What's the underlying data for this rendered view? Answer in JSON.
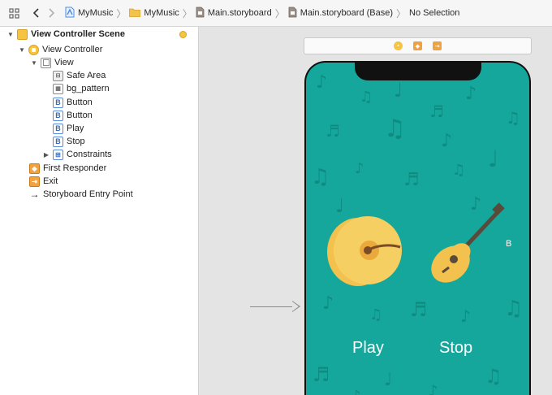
{
  "jumpbar": {
    "crumbs": [
      {
        "label": "MyMusic",
        "icon": "project-icon"
      },
      {
        "label": "MyMusic",
        "icon": "folder-icon"
      },
      {
        "label": "Main.storyboard",
        "icon": "storyboard-file-icon"
      },
      {
        "label": "Main.storyboard (Base)",
        "icon": "storyboard-file-icon"
      },
      {
        "label": "No Selection",
        "icon": ""
      }
    ],
    "colors": {
      "folder": "#f2c14e",
      "project": "#4a90e2"
    }
  },
  "outline": {
    "scene": "View Controller Scene",
    "view_controller": "View Controller",
    "view": "View",
    "children": [
      "Safe Area",
      "bg_pattern",
      "Button",
      "Button",
      "Play",
      "Stop",
      "Constraints"
    ],
    "first_responder": "First Responder",
    "exit": "Exit",
    "entry_point": "Storyboard Entry Point"
  },
  "canvas": {
    "background_color": "#15a79b",
    "play_label": "Play",
    "stop_label": "Stop",
    "clipped_button_label": "B"
  }
}
